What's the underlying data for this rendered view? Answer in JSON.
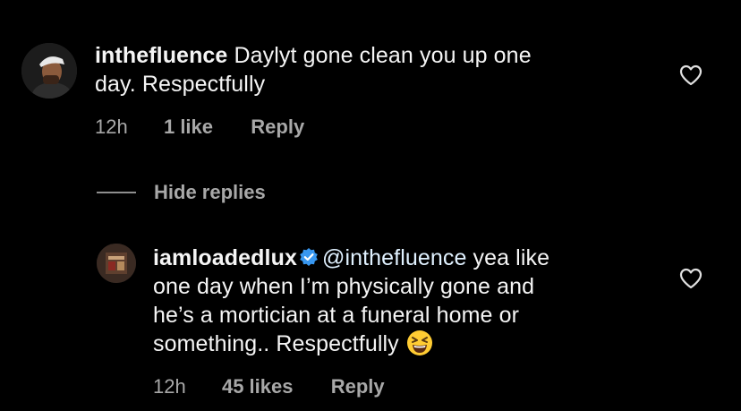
{
  "comments": [
    {
      "username": "inthefluence",
      "text_line1": "Daylyt gone clean you up one",
      "text_line2": "day. Respectfully",
      "time": "12h",
      "likes": "1 like",
      "reply": "Reply",
      "avatar_icon": "user-avatar-photo",
      "like_icon": "heart-outline-icon"
    },
    {
      "username": "iamloadedlux",
      "verified_icon": "verified-badge-icon",
      "mention": "@inthefluence",
      "text_line1": "yea like",
      "text_line2": "one day when I’m physically gone and",
      "text_line3": "he’s a mortician at a funeral home or",
      "text_line4": "something.. Respectfully",
      "emoji_icon": "grinning-squinting-face-emoji",
      "time": "12h",
      "likes": "45 likes",
      "reply": "Reply",
      "avatar_icon": "album-cover-avatar",
      "like_icon": "heart-outline-icon"
    }
  ],
  "hide_replies": {
    "label": "Hide replies"
  },
  "colors": {
    "background": "#000000",
    "text": "#f5f5f5",
    "muted": "#a8a8a8",
    "verified": "#3897f0",
    "mention": "#e0f1ff"
  }
}
